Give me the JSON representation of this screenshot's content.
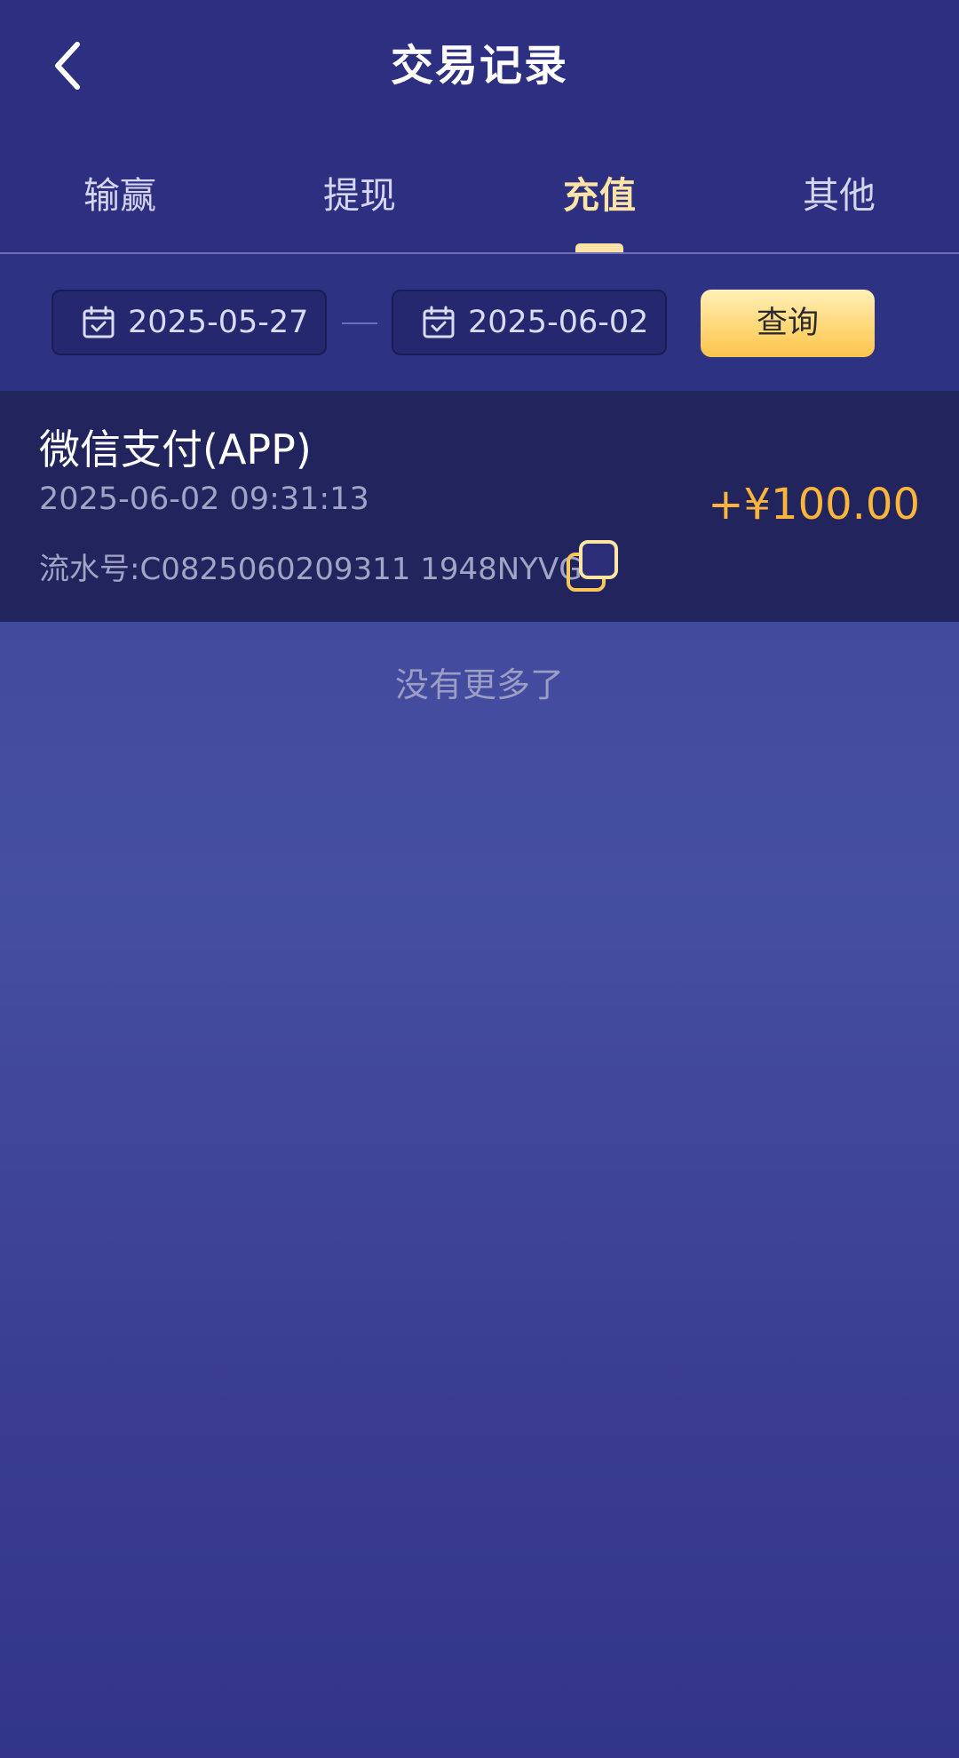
{
  "header": {
    "title": "交易记录",
    "back_icon": "chevron-left-icon"
  },
  "tabs": [
    {
      "label": "输赢",
      "active": false
    },
    {
      "label": "提现",
      "active": false
    },
    {
      "label": "充值",
      "active": true
    },
    {
      "label": "其他",
      "active": false
    }
  ],
  "filter": {
    "start_date": "2025-05-27",
    "end_date": "2025-06-02",
    "calendar_icon": "calendar-check-icon",
    "query_label": "查询"
  },
  "records": [
    {
      "title": "微信支付(APP)",
      "time": "2025-06-02 09:31:13",
      "serial": "流水号:C0825060209311 1948NYVG",
      "amount": "+¥100.00",
      "copy_icon": "copy-icon"
    }
  ],
  "footer": {
    "no_more": "没有更多了"
  },
  "colors": {
    "header_bg": "#2d2f80",
    "active_tab": "#fde3a6",
    "amount": "#fcb53b",
    "record_bg": "#22245d"
  }
}
